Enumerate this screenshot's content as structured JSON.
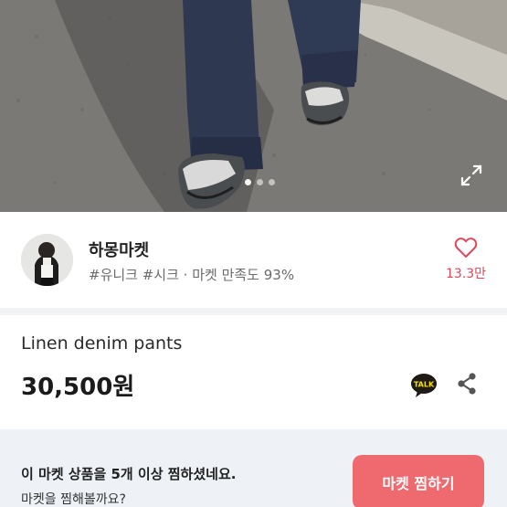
{
  "seller": {
    "name": "하몽마켓",
    "meta": "#유니크 #시크 · 마켓 만족도 93%",
    "favorites": "13.3만"
  },
  "product": {
    "title": "Linen denim pants",
    "price": "30,500원"
  },
  "banner": {
    "title": "이 마켓 상품을 5개 이상 찜하셨네요.",
    "subtitle": "마켓을 찜해볼까요?",
    "button_label": "마켓 찜하기"
  },
  "carousel": {
    "pages": 3,
    "current_page": 1
  },
  "icons": {
    "expand": "expand-icon",
    "favorite": "heart-icon",
    "talk": "kakaotalk-icon",
    "share": "share-icon"
  },
  "colors": {
    "accent": "#ef6a6f",
    "favorite_count": "#e0475b",
    "banner_bg": "#eef2f7",
    "talk_yellow": "#fae100"
  }
}
